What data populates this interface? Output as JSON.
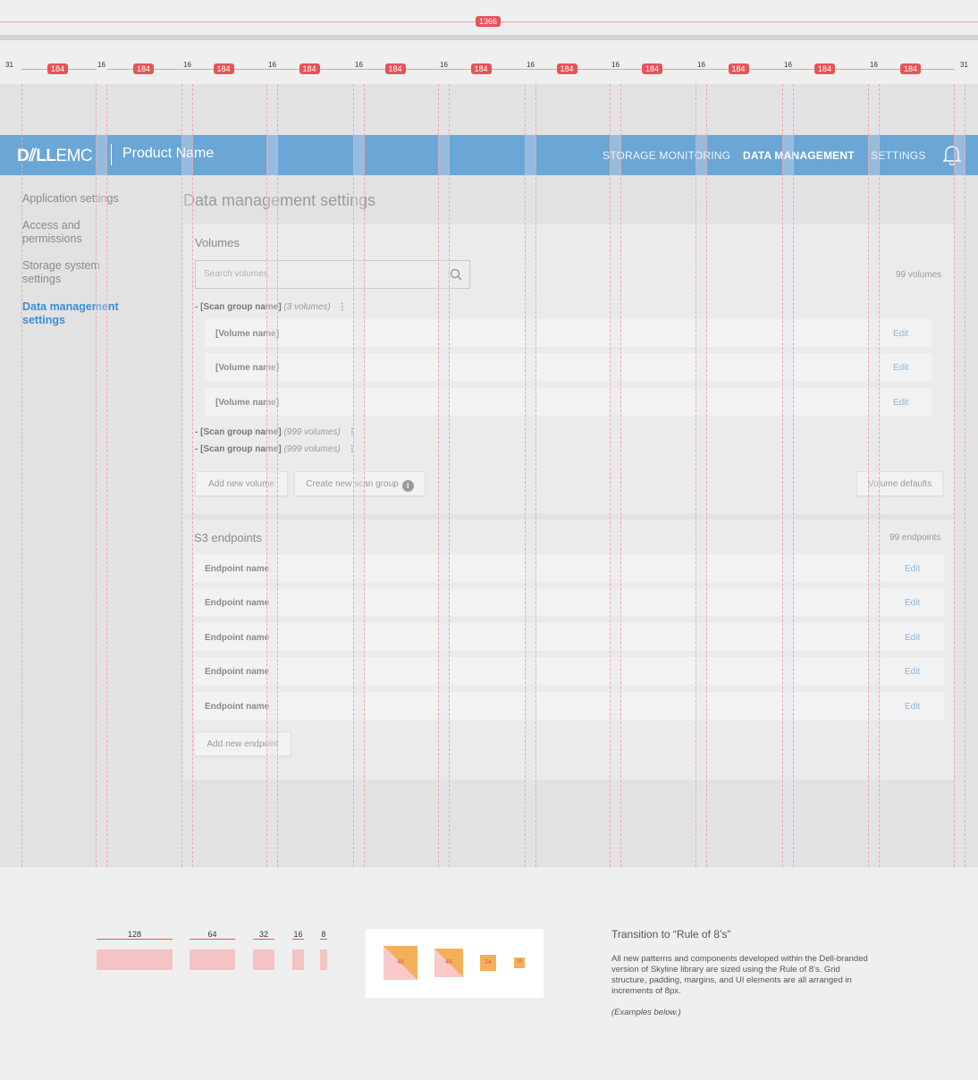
{
  "spec": {
    "total_width_label": "1366",
    "margin_label": "31",
    "column_label": "184",
    "gutter_label": "16"
  },
  "app": {
    "logo_dell": "D⫽LL",
    "logo_emc": "EMC",
    "product_name": "Product Name",
    "nav": [
      "STORAGE MONITORING",
      "DATA MANAGEMENT",
      "SETTINGS"
    ],
    "active_nav": "DATA MANAGEMENT",
    "accent_color": "#6aa6d6",
    "link_color": "#3b8fd6"
  },
  "sidebar": {
    "items": [
      {
        "label": "Application settings"
      },
      {
        "label": "Access and permissions"
      },
      {
        "label": "Storage system settings"
      },
      {
        "label": "Data management settings",
        "active": true
      }
    ]
  },
  "page": {
    "title": "Data management settings"
  },
  "volumes": {
    "title": "Volumes",
    "search_placeholder": "Search volumes",
    "count": "99 volumes",
    "groups": [
      {
        "name": "- [Scan group name]",
        "count": "(3 volumes)"
      },
      {
        "name": "- [Scan group name]",
        "count": "(999 volumes)"
      },
      {
        "name": "- [Scan group name]",
        "count": "(999 volumes)"
      }
    ],
    "rows": [
      {
        "name": "[Volume name]",
        "action": "Edit"
      },
      {
        "name": "[Volume name]",
        "action": "Edit"
      },
      {
        "name": "[Volume name]",
        "action": "Edit"
      }
    ],
    "add_button": "Add new volume",
    "create_group_button": "Create new scan group",
    "defaults_button": "Volume defaults"
  },
  "s3": {
    "title": "S3 endpoints",
    "count": "99 endpoints",
    "rows": [
      {
        "name": "Endpoint name",
        "action": "Edit"
      },
      {
        "name": "Endpoint name",
        "action": "Edit"
      },
      {
        "name": "Endpoint name",
        "action": "Edit"
      },
      {
        "name": "Endpoint name",
        "action": "Edit"
      },
      {
        "name": "Endpoint name",
        "action": "Edit"
      }
    ],
    "add_button": "Add new endpoint"
  },
  "legend": {
    "sizes": [
      "128",
      "64",
      "32",
      "16",
      "8"
    ],
    "icon_sizes": [
      "48",
      "48",
      "24",
      "16"
    ],
    "title": "Transition to “Rule of 8’s”",
    "body": "All new patterns and components developed within the Dell-branded version of Skyline library are sized using the Rule of 8's. Grid structure, padding, margins, and UI elements are all arranged in increments of 8px.",
    "example_note": "(Examples below.)"
  }
}
